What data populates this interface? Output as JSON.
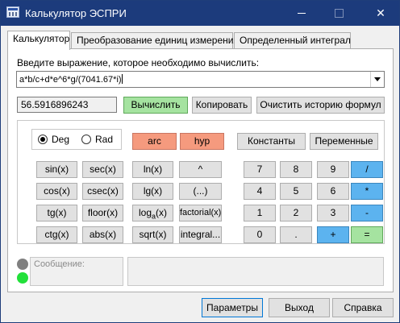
{
  "window": {
    "title": "Калькулятор ЭСПРИ",
    "close_glyph": "✕"
  },
  "tabs": [
    {
      "label": "Калькулятор"
    },
    {
      "label": "Преобразование единиц измерения"
    },
    {
      "label": "Определенный интеграл"
    }
  ],
  "calculator": {
    "prompt": "Введите выражение, которое необходимо вычислить:",
    "expression": "a*b/c+d*e^6*g/(7041.67*i)",
    "result": "56.5916896243",
    "calculate_label": "Вычислить",
    "copy_label": "Копировать",
    "clear_history_label": "Очистить историю формул"
  },
  "angle": {
    "deg_label": "Deg",
    "rad_label": "Rad",
    "selected": "Deg"
  },
  "modes": {
    "arc_label": "arc",
    "hyp_label": "hyp"
  },
  "side_buttons": {
    "constants_label": "Константы",
    "variables_label": "Переменные"
  },
  "function_keys": {
    "sin": "sin(x)",
    "sec": "sec(x)",
    "ln": "ln(x)",
    "pow": "^",
    "cos": "cos(x)",
    "csec": "csec(x)",
    "lg": "lg(x)",
    "paren": "(...)",
    "tg": "tg(x)",
    "floor": "floor(x)",
    "loga_prefix": "log",
    "loga_sub": "a",
    "loga_suffix": "(x)",
    "factorial": "factorial(x)",
    "ctg": "ctg(x)",
    "abs": "abs(x)",
    "sqrt": "sqrt(x)",
    "integral": "integral..."
  },
  "digit_keys": {
    "d7": "7",
    "d8": "8",
    "d9": "9",
    "div": "/",
    "d4": "4",
    "d5": "5",
    "d6": "6",
    "mul": "*",
    "d1": "1",
    "d2": "2",
    "d3": "3",
    "sub": "-",
    "d0": "0",
    "dot": ".",
    "add": "+",
    "eq": "="
  },
  "status": {
    "message_label": "Сообщение:",
    "message_text": ""
  },
  "footer": {
    "params_label": "Параметры",
    "exit_label": "Выход",
    "help_label": "Справка"
  },
  "colors": {
    "titlebar": "#1c3b7c",
    "green_button": "#a5e3a0",
    "salmon_button": "#f59a7e",
    "blue_button": "#5cb3ef",
    "status_ok": "#22e03a",
    "status_idle": "#808080"
  },
  "icons": {
    "app": "calculator-app-icon",
    "minimize": "minimize-icon",
    "maximize": "maximize-icon",
    "close": "close-icon",
    "dropdown": "chevron-down-icon"
  }
}
